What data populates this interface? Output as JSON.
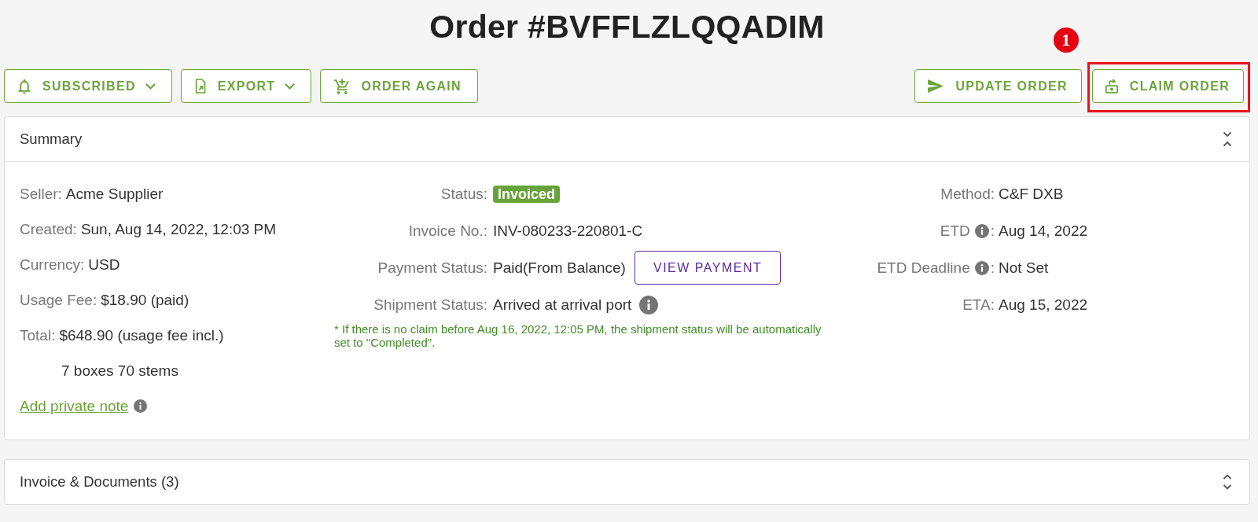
{
  "title": "Order #BVFFLZLQQADIM",
  "toolbar": {
    "left": [
      {
        "label": "SUBSCRIBED",
        "dropdown": true
      },
      {
        "label": "EXPORT",
        "dropdown": true
      },
      {
        "label": "ORDER AGAIN",
        "dropdown": false
      }
    ],
    "right": [
      {
        "label": "UPDATE ORDER",
        "highlighted": false
      },
      {
        "label": "CLAIM ORDER",
        "highlighted": true,
        "callout": "1"
      }
    ]
  },
  "panels": [
    {
      "title": "Summary",
      "expanded": true,
      "details": {
        "left": [
          {
            "label": "Seller:",
            "value": "Acme Supplier"
          },
          {
            "label": "Created:",
            "value": "Sun, Aug 14, 2022, 12:03 PM"
          },
          {
            "label": "Currency:",
            "value": "USD"
          },
          {
            "label": "Usage Fee:",
            "value": "$18.90 (paid)"
          },
          {
            "label": "Total:",
            "value": "$648.90 (usage fee incl.)"
          },
          {
            "value": "7 boxes 70 stems"
          }
        ],
        "note_link": {
          "label": "Add private note",
          "info": true
        },
        "middle": [
          {
            "kind": "badge",
            "label": "Status:",
            "value": "Invoiced",
            "info": false
          },
          {
            "kind": "text",
            "label": "Invoice No.:",
            "value": "INV-080233-220801-C",
            "info": false
          },
          {
            "kind": "action",
            "label": "Payment Status:",
            "value": "Paid(From Balance)",
            "button": "VIEW PAYMENT",
            "info": false
          },
          {
            "kind": "text",
            "label": "Shipment Status:",
            "value": "Arrived at arrival port",
            "info": true
          }
        ],
        "note": "* If there is no claim before Aug 16, 2022, 12:05 PM, the shipment status will be automatically set to \"Completed\".",
        "right": [
          {
            "label": "Method:",
            "value": "C&F DXB",
            "info": false
          },
          {
            "label": "ETD",
            "label_tail": ":",
            "value": "Aug 14, 2022",
            "info": true
          },
          {
            "label": "ETD Deadline",
            "label_tail": ":",
            "value": "Not Set",
            "info": true
          },
          {
            "label": "ETA:",
            "value": "Aug 15, 2022",
            "info": false
          }
        ]
      }
    },
    {
      "title": "Invoice & Documents (3)",
      "expanded": false
    }
  ]
}
